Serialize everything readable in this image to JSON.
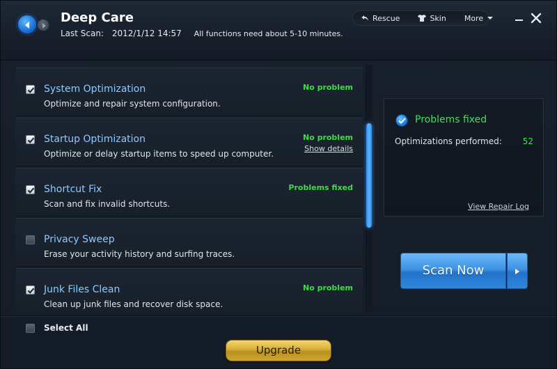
{
  "window": {
    "title": "Deep Care",
    "last_scan_label": "Last Scan:",
    "last_scan_value": "2012/1/12 14:57",
    "info_text": "All functions need about 5-10 minutes."
  },
  "toolbar": {
    "rescue_label": "Rescue",
    "skin_label": "Skin",
    "more_label": "More"
  },
  "items": [
    {
      "title": "System Optimization",
      "description": "Optimize and repair system configuration.",
      "status": "No problem",
      "checked": true
    },
    {
      "title": "Startup Optimization",
      "description": "Optimize or delay startup items to speed up computer.",
      "status": "No problem",
      "link": "Show details",
      "checked": true
    },
    {
      "title": "Shortcut Fix",
      "description": "Scan and fix invalid shortcuts.",
      "status": "Problems fixed",
      "checked": true
    },
    {
      "title": "Privacy Sweep",
      "description": "Erase your activity history and surfing traces.",
      "status": "",
      "checked": false
    },
    {
      "title": "Junk Files Clean",
      "description": "Clean up junk files and recover disk space.",
      "status": "No problem",
      "checked": true
    }
  ],
  "result": {
    "title": "Problems fixed",
    "label": "Optimizations performed:",
    "value": "52",
    "log_link": "View Repair Log"
  },
  "scan_button_label": "Scan Now",
  "select_all_label": "Select All",
  "upgrade_label": "Upgrade",
  "colors": {
    "accent_blue": "#3f93e2",
    "status_green": "#3fdc4a",
    "item_title": "#8fcaff",
    "upgrade_gold": "#d6ae35"
  }
}
